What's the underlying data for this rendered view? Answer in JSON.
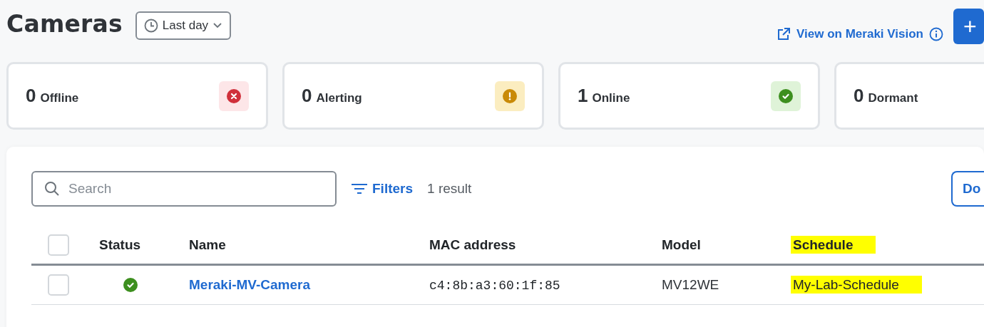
{
  "header": {
    "title": "Cameras",
    "time_range": "Last day",
    "link": "View on Meraki Vision",
    "add_button": "+"
  },
  "summary_cards": [
    {
      "count": "0",
      "label": "Offline",
      "kind": "error"
    },
    {
      "count": "0",
      "label": "Alerting",
      "kind": "warning"
    },
    {
      "count": "1",
      "label": "Online",
      "kind": "success"
    },
    {
      "count": "0",
      "label": "Dormant",
      "kind": "none"
    }
  ],
  "toolbar": {
    "search_placeholder": "Search",
    "filters": "Filters",
    "result_count": "1 result",
    "action_button": "Do"
  },
  "table": {
    "select_all_checked": false,
    "columns": [
      {
        "label": "Status",
        "highlighted": false
      },
      {
        "label": "Name",
        "highlighted": false
      },
      {
        "label": "MAC address",
        "highlighted": false
      },
      {
        "label": "Model",
        "highlighted": false
      },
      {
        "label": "Schedule",
        "highlighted": true
      }
    ],
    "rows": [
      {
        "checked": false,
        "kind": "online",
        "name": "Meraki-MV-Camera",
        "mac": "c4:8b:a3:60:1f:85",
        "model": "MV12WE",
        "schedule": "My-Lab-Schedule",
        "schedule_highlighted": true
      }
    ]
  }
}
